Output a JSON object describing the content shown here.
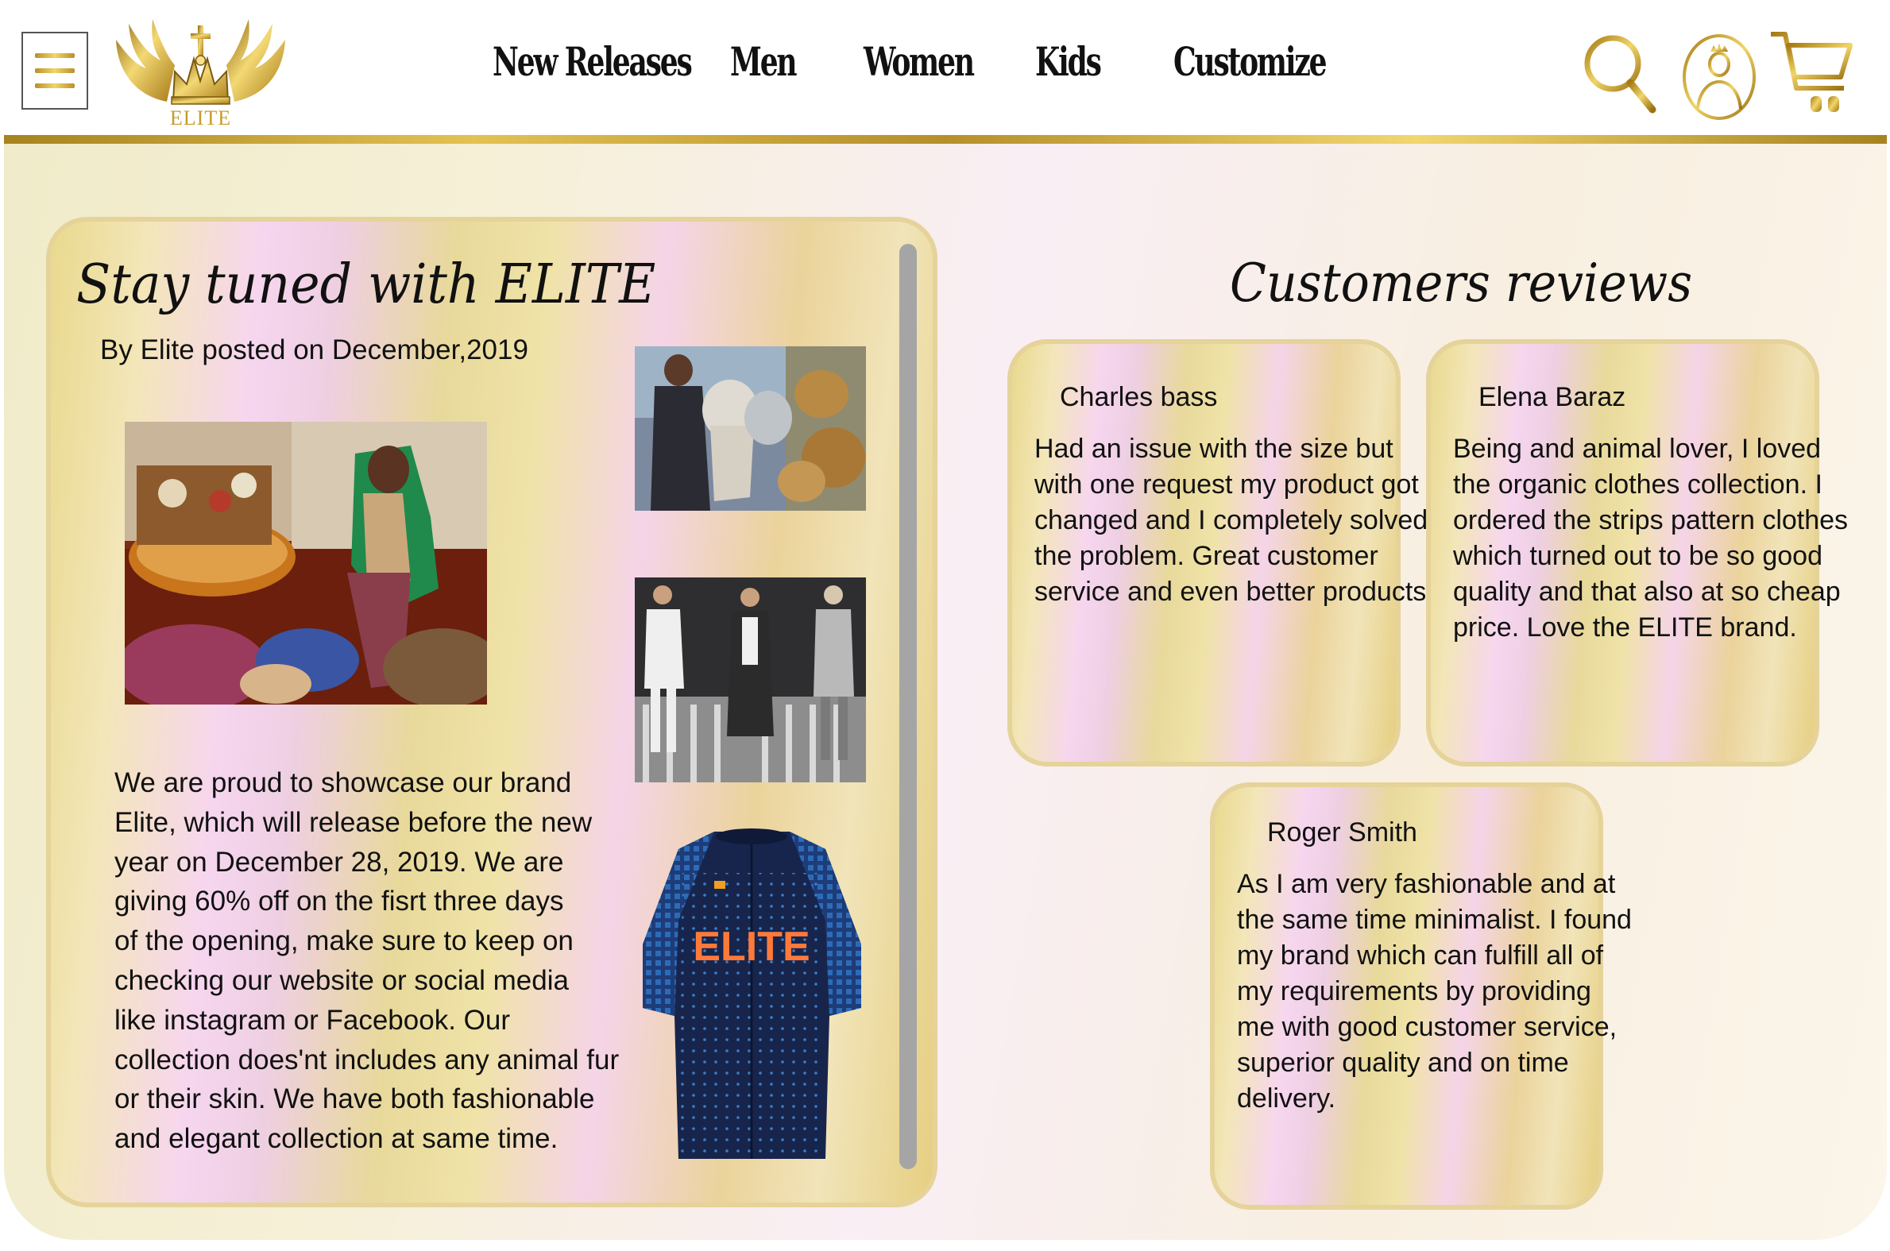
{
  "brand": {
    "logo_text": "ELITE",
    "accent_gold": "#c79b2b",
    "text_color": "#111111"
  },
  "header": {
    "menu_icon": "hamburger-menu-icon",
    "nav": [
      {
        "label": "New Releases"
      },
      {
        "label": "Men"
      },
      {
        "label": "Women"
      },
      {
        "label": "Kids"
      },
      {
        "label": "Customize"
      }
    ],
    "icons": [
      "search-icon",
      "account-icon",
      "cart-icon"
    ]
  },
  "news": {
    "title": "Stay tuned with  ELITE",
    "byline": "By Elite posted on December,2019",
    "body_lines": [
      "We are proud to showcase our brand",
      "Elite, which will release before the new",
      "year on December 28, 2019. We are",
      "giving 60% off on the fisrt three days",
      "of the opening, make sure to keep on",
      "checking our website or social media",
      "like instagram or Facebook. Our",
      "collection does'nt includes any animal fur",
      "or their skin. We have both fashionable",
      "and elegant collection at same time."
    ],
    "images": [
      "fashion-interior-photo",
      "animals-collage-photo",
      "runway-models-photo",
      "elite-jersey-photo"
    ],
    "jersey_print": "ELITE"
  },
  "reviews": {
    "title": "Customers reviews",
    "items": [
      {
        "name": "Charles bass",
        "lines": [
          "Had an issue with the size but",
          "with one request my product got",
          "changed and I completely solved",
          "the problem. Great customer",
          "service and even better products."
        ]
      },
      {
        "name": "Elena Baraz",
        "lines": [
          "Being and animal lover, I loved",
          "the organic clothes collection. I",
          "ordered the strips pattern clothes",
          "which turned out to be so good",
          "quality and that also at so cheap",
          "price. Love the ELITE brand."
        ]
      },
      {
        "name": "Roger Smith",
        "lines": [
          "As I am very fashionable and at",
          "the same time minimalist. I found",
          "my brand which can fulfill all of",
          "my requirements by providing",
          "me with good customer service,",
          "superior quality and on time",
          "delivery."
        ]
      }
    ]
  }
}
